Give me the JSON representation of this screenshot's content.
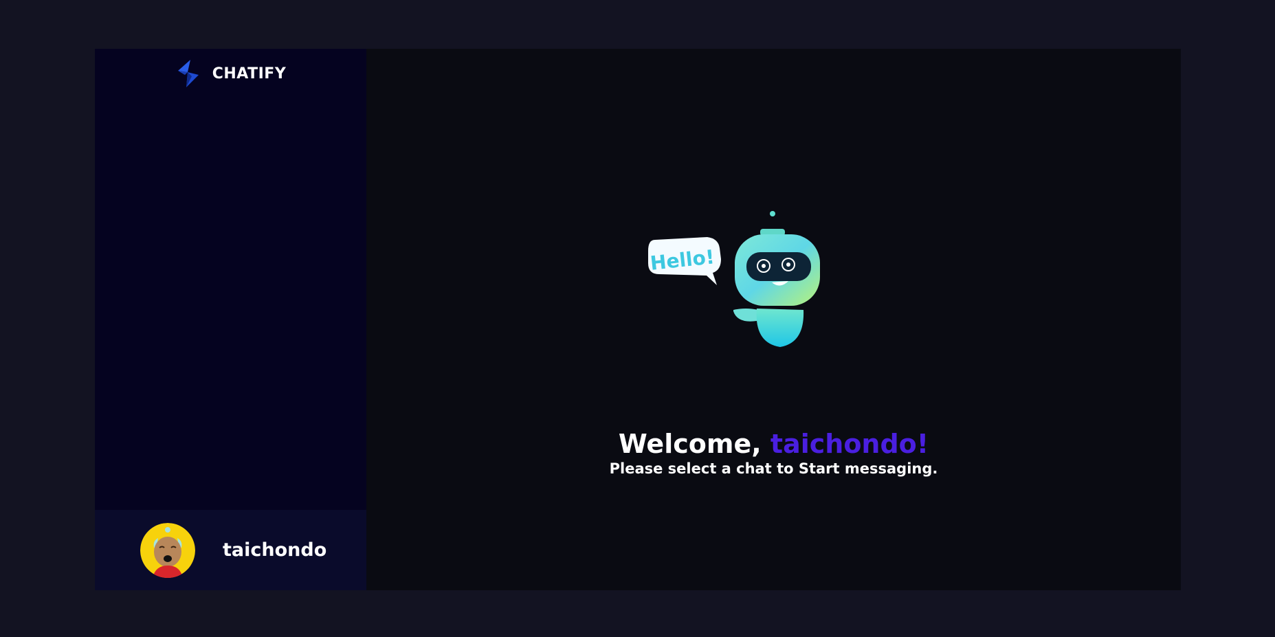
{
  "app": {
    "name": "CHATIFY"
  },
  "sidebar": {
    "user": {
      "name": "taichondo"
    }
  },
  "main": {
    "illustration_text": "Hello!",
    "welcome_prefix": "Welcome, ",
    "welcome_name": "taichondo!",
    "subtitle": "Please select a chat to Start messaging."
  },
  "colors": {
    "page_bg": "#131322",
    "sidebar_bg": "#050320",
    "user_bar_bg": "#0a0b2b",
    "main_bg": "#0a0b12",
    "accent": "#4a1fe0"
  }
}
